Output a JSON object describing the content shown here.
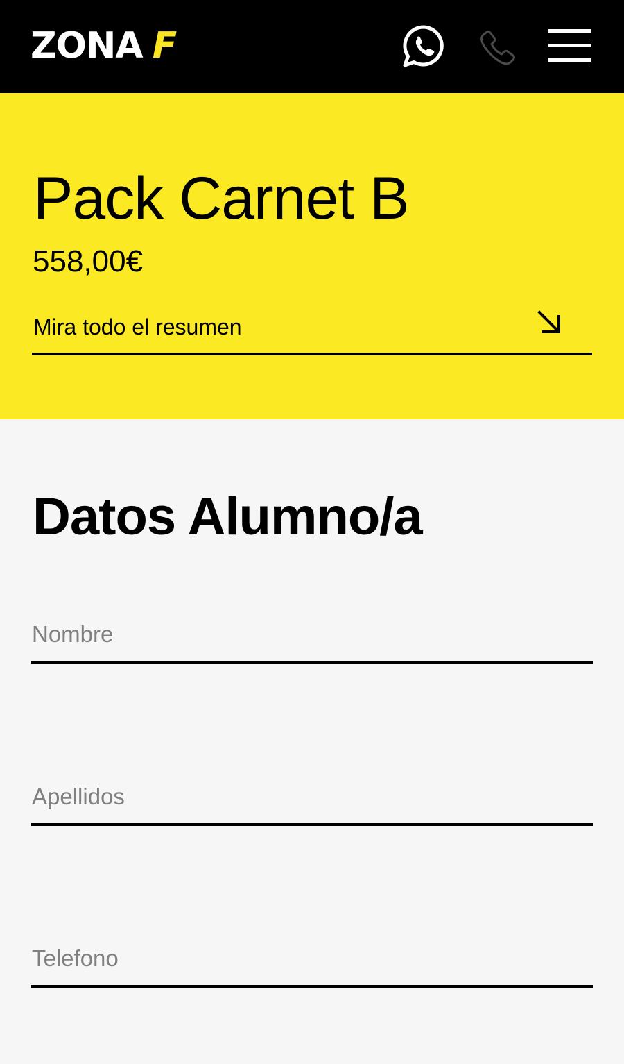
{
  "header": {
    "logo_main": "ZONA",
    "logo_accent": "F",
    "whatsapp_icon": "whatsapp-icon",
    "phone_icon": "phone-icon",
    "menu_icon": "hamburger-menu-icon"
  },
  "summary": {
    "title": "Pack Carnet B",
    "price": "558,00€",
    "link_label": "Mira todo el resumen",
    "link_icon": "arrow-down-right-icon"
  },
  "form": {
    "title": "Datos Alumno/a",
    "fields": [
      {
        "placeholder": "Nombre",
        "value": ""
      },
      {
        "placeholder": "Apellidos",
        "value": ""
      },
      {
        "placeholder": "Telefono",
        "value": ""
      }
    ]
  },
  "colors": {
    "header_bg": "#000000",
    "brand_yellow": "#fbe923",
    "page_bg": "#f6f6f6",
    "placeholder": "#808080"
  }
}
